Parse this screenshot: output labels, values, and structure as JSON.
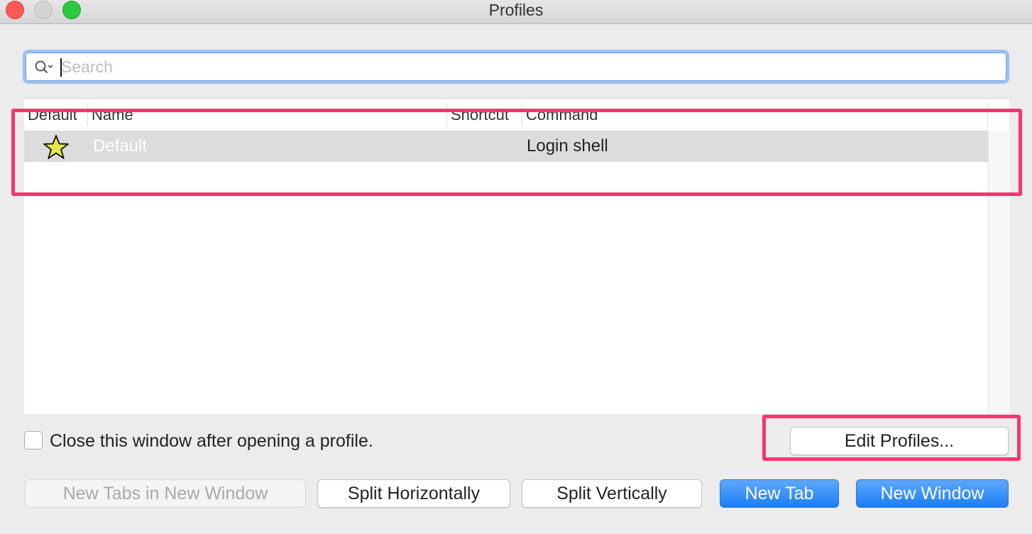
{
  "window": {
    "title": "Profiles",
    "controls": {
      "close": "close-window",
      "minimize": "minimize-window",
      "maximize": "zoom-window"
    }
  },
  "search": {
    "placeholder": "Search",
    "value": "",
    "icon": "search-icon"
  },
  "table": {
    "columns": [
      "Default",
      "Name",
      "Shortcut",
      "Command"
    ],
    "rows": [
      {
        "default_icon": "star-icon",
        "is_default": true,
        "name": "Default",
        "shortcut": "",
        "command": "Login shell",
        "selected": true
      }
    ]
  },
  "options": {
    "close_after_open_label": "Close this window after opening a profile.",
    "close_after_open_checked": false
  },
  "buttons": {
    "edit_profiles": "Edit Profiles...",
    "new_tabs_in_new_window": "New Tabs in New Window",
    "split_horizontally": "Split Horizontally",
    "split_vertically": "Split Vertically",
    "new_tab": "New Tab",
    "new_window": "New Window"
  },
  "annotations": {
    "highlight_color": "#f8346f"
  },
  "colors": {
    "accent_blue": "#1a7ef5",
    "selected_row": "#dcdcdc",
    "star_fill": "#e8e64f"
  }
}
